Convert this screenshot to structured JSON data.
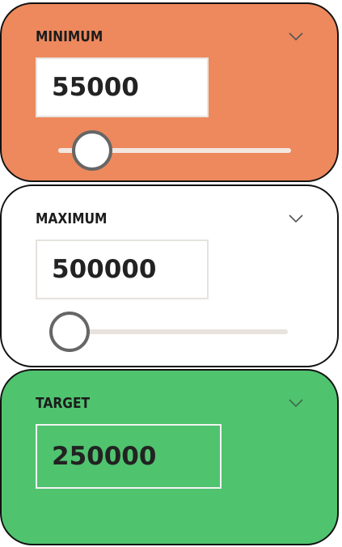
{
  "colors": {
    "minimum_panel": "#ed895d",
    "maximum_panel": "#ffffff",
    "target_panel": "#50c36f",
    "track_min": "#f2e7e0",
    "track_max": "#e8e3de",
    "thumb_border": "#666666"
  },
  "panels": {
    "minimum": {
      "label": "MINIMUM",
      "value": "55000",
      "icon": "chevron-down-icon",
      "slider_fraction": 0.11
    },
    "maximum": {
      "label": "MAXIMUM",
      "value": "500000",
      "icon": "chevron-down-icon",
      "slider_fraction": 0.0
    },
    "target": {
      "label": "TARGET",
      "value": "250000",
      "icon": "chevron-down-icon"
    }
  }
}
